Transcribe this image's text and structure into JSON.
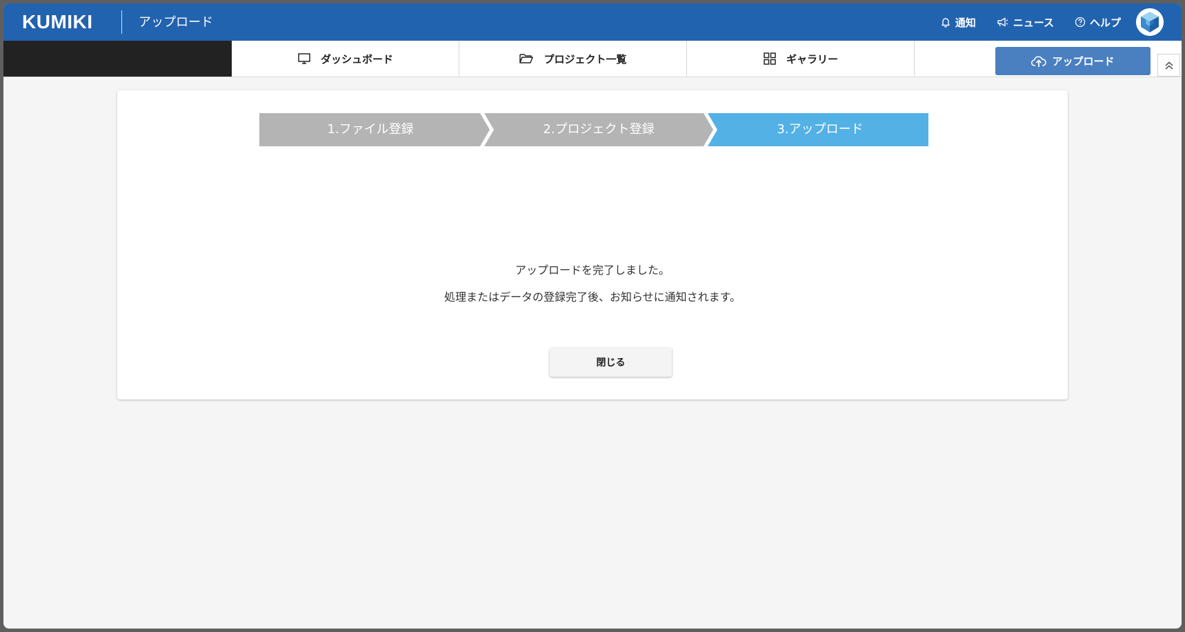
{
  "header": {
    "brand": "KUMIKI",
    "subtitle": "アップロード",
    "links": [
      {
        "label": "通知",
        "icon": "bell-icon"
      },
      {
        "label": "ニュース",
        "icon": "megaphone-icon"
      },
      {
        "label": "ヘルプ",
        "icon": "help-circle-icon"
      }
    ],
    "avatar_icon": "cube-avatar-icon"
  },
  "nav": {
    "tabs": [
      {
        "label": "ダッシュボード",
        "icon": "monitor-icon"
      },
      {
        "label": "プロジェクト一覧",
        "icon": "folder-icon"
      },
      {
        "label": "ギャラリー",
        "icon": "grid-icon"
      }
    ],
    "upload_button": {
      "label": "アップロード",
      "icon": "cloud-upload-icon"
    },
    "collapse_icon": "chevron-double-up-icon"
  },
  "steps": [
    {
      "label": "1.ファイル登録",
      "state": "done"
    },
    {
      "label": "2.プロジェクト登録",
      "state": "done"
    },
    {
      "label": "3.アップロード",
      "state": "current"
    }
  ],
  "main": {
    "message_line1": "アップロードを完了しました。",
    "message_line2": "処理またはデータの登録完了後、お知らせに通知されます。",
    "close_button": "閉じる"
  },
  "colors": {
    "header_bg": "#2263b0",
    "step_inactive": "#b4b4b4",
    "step_active": "#53b1e6",
    "upload_button": "#4a7fc0"
  }
}
